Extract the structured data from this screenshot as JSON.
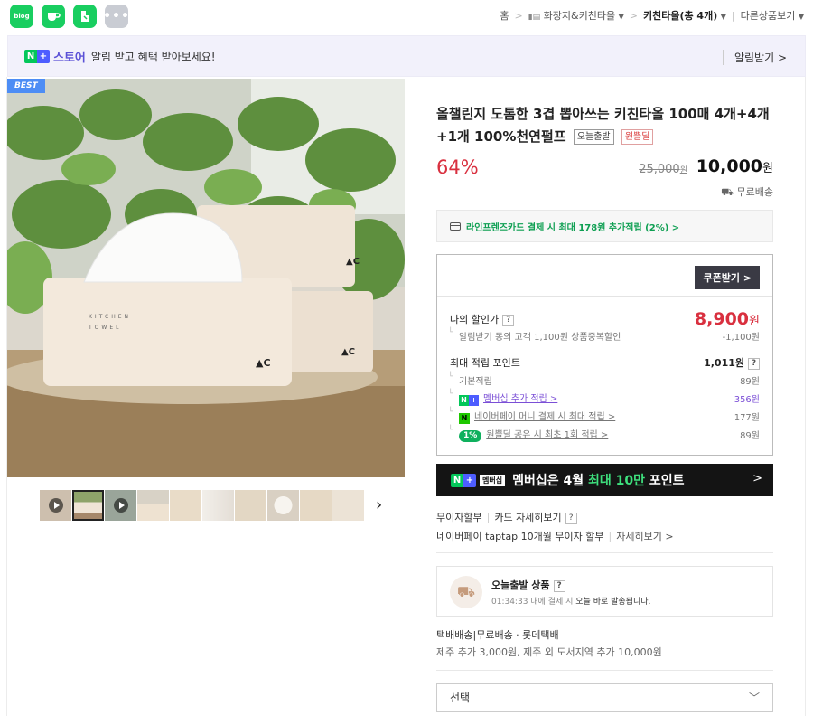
{
  "share": {
    "blog": "blog",
    "more": "•••"
  },
  "breadcrumb": {
    "home": "홈",
    "cat1": "화장지&키친타올",
    "cat2": "키친타올(총 4개)",
    "other": "다른상품보기"
  },
  "store_banner": {
    "brand": "스토어",
    "text": "알림 받고 혜택 받아보세요!",
    "action": "알림받기 >"
  },
  "product_image": {
    "badge": "BEST",
    "box_text": "KITCHEN TOWEL"
  },
  "thumbnails": {
    "count": 10,
    "active_index": 1,
    "video_indices": [
      0,
      2
    ]
  },
  "product": {
    "title": "올챌린지 도톰한 3겹 뽑아쓰는 키친타올 100매 4개+4개+1개 100%천연펄프",
    "tag_today": "오늘출발",
    "tag_onepick": "원쁠딜",
    "discount_rate": "64%",
    "original_price": "25,000",
    "original_unit": "원",
    "sale_price": "10,000",
    "sale_unit": "원",
    "shipping": "무료배송"
  },
  "card_promo": "라인프렌즈카드 결제 시 최대 178원 추가적립 (2%) >",
  "benefit": {
    "coupon_button": "쿠폰받기 >",
    "my_price_label": "나의 할인가",
    "my_price_value": "8,900",
    "my_price_unit": "원",
    "my_price_sub": "알림받기 동의 고객 1,100원 상품중복할인",
    "my_price_sub_value": "-1,100원",
    "points_label": "최대 적립 포인트",
    "points_value": "1,011원",
    "basic_label": "기본적립",
    "basic_value": "89원",
    "membership_label": "멤버십 추가 적립 >",
    "membership_value": "356원",
    "npay_label": "네이버페이 머니 결제 시 최대 적립 >",
    "npay_value": "177원",
    "onepick_badge": "1%",
    "onepick_label": "원쁠딜 공유 시 최초 1회 적립 >",
    "onepick_value": "89원",
    "qmark": "?"
  },
  "membership_banner": {
    "tag": "멤버십",
    "text_before": "멤버십은 4월 ",
    "text_highlight": "최대 10만",
    "text_after": " 포인트",
    "arrow": ">"
  },
  "payment": {
    "installment": "무이자할부",
    "card_detail": "카드 자세히보기",
    "taptap": "네이버페이 taptap 10개월 무이자 할부",
    "taptap_detail": "자세히보기 >"
  },
  "today_ship": {
    "title": "오늘출발 상품",
    "time": "01:34:33 내에 결제 시",
    "text": "오늘 바로 발송됩니다."
  },
  "delivery": {
    "type": "택배배송",
    "fee": "무료배송 · 롯데택배",
    "extra": "제주 추가 3,000원, 제주 외 도서지역 추가 10,000원"
  },
  "option_select": {
    "placeholder": "선택"
  },
  "colors": {
    "accent_red": "#d9303f",
    "naver_green": "#03c75a",
    "purple": "#7b4fd6",
    "best_blue": "#4d8df5"
  }
}
